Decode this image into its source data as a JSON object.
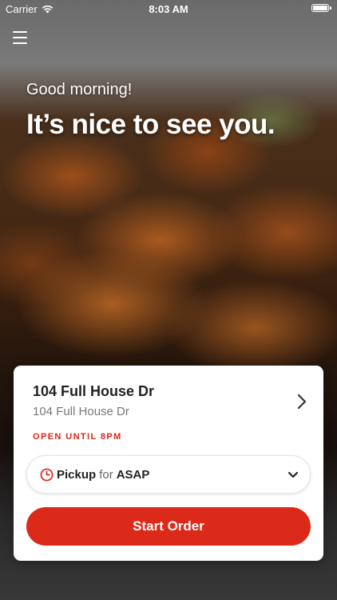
{
  "status_bar": {
    "carrier": "Carrier",
    "time": "8:03 AM",
    "wifi_icon": "wifi-icon",
    "battery_icon": "battery-icon"
  },
  "header": {
    "menu_icon": "hamburger-menu-icon"
  },
  "hero": {
    "greeting": "Good morning!",
    "headline": "It’s nice to see you."
  },
  "store_card": {
    "name": "104 Full House Dr",
    "address": "104 Full House Dr",
    "hours": "OPEN UNTIL 8PM",
    "chevron_icon": "chevron-right-icon",
    "pickup": {
      "mode": "Pickup",
      "connector": "for",
      "time": "ASAP",
      "icon": "clock-icon",
      "dropdown_icon": "chevron-down-icon"
    },
    "start_order_label": "Start Order"
  },
  "colors": {
    "accent": "#dc2a1a",
    "hours_text": "#d9261c",
    "card_background": "#ffffff"
  }
}
